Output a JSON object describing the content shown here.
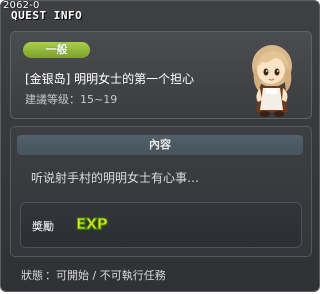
{
  "quest_id": "2062-0",
  "window": {
    "title": "QUEST INFO"
  },
  "quest": {
    "category": "一般",
    "title": "[金银岛] 明明女士的第一个担心",
    "level": "建議等级：15~19"
  },
  "content": {
    "header": "內容",
    "text": "听说射手村的明明女士有心事…"
  },
  "reward": {
    "label": "奬勵",
    "exp": "EXP"
  },
  "status": {
    "label": "狀態",
    "value": "：可開始 / 不可執行任務"
  },
  "colors": {
    "window_bg": "#36383b",
    "badge": "#8db53a",
    "title_accent": "#e8d63a",
    "exp": "#f0e020"
  }
}
